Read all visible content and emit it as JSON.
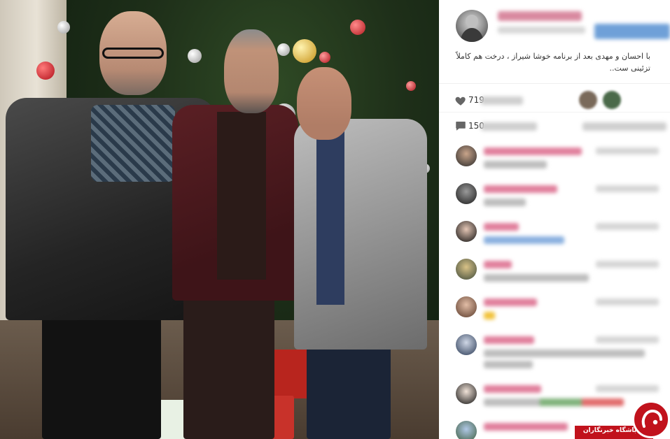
{
  "post": {
    "caption": "با احسان و مهدی بعد از برنامه خوشا شیراز ، درخت هم کاملاً تزئینی ست..",
    "likes_count": "719",
    "comments_count": "150"
  },
  "watermark": {
    "text": "باشگاه خبرنگاران"
  },
  "colors": {
    "accent_pink": "#e07e9b",
    "share_blue": "#6fa0d8",
    "watermark_red": "#c1121c"
  },
  "icons": {
    "likes": "heart-icon",
    "comments": "speech-bubble-icon"
  }
}
